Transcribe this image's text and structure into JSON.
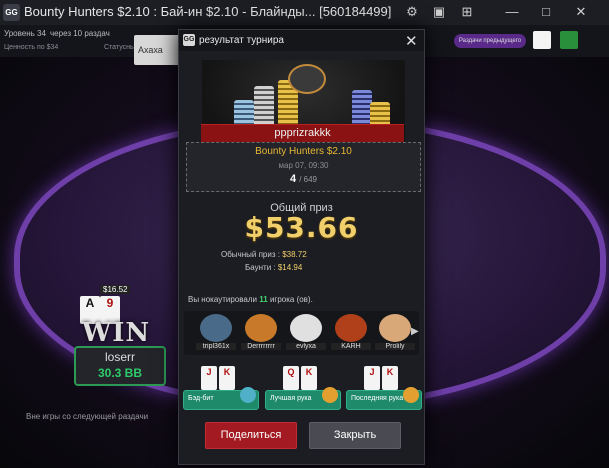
{
  "window": {
    "title": "Bounty Hunters $2.10 : Бай-ин $2.10 - Блайнды... [560184499]",
    "logo": "GG",
    "gear_icon": "gear-icon",
    "minimize_icon": "minimize-icon",
    "restore_icon": "restore-icon",
    "close_icon": "close-icon"
  },
  "info": {
    "level": "Уровень 34",
    "next_level": "через 10 раздач",
    "line2a": "Ценность по $34",
    "line2b": "Статусный бонус"
  },
  "table": {
    "chat_text": "Ахаха",
    "right_pill": "Раздачи предыдущего",
    "player": {
      "name": "loserr",
      "stack": "30.3 BB",
      "win_text": "WIN",
      "chip_amount": "$16.52",
      "cards": [
        "A",
        "9"
      ]
    },
    "sitout_text": "Вне игры со следующей раздачи"
  },
  "modal": {
    "title": "результат турнира",
    "winner": "ppprizrakkk",
    "tournament": "Bounty Hunters $2.10",
    "date": "мар 07, 09:30",
    "place": "4",
    "total": "/ 649",
    "prize_label": "Общий приз",
    "prize_amount": "$53.66",
    "regular_label": "Обычный приз :",
    "regular_value": "$38.72",
    "bounty_label": "Баунти :",
    "bounty_value": "$14.94",
    "knocked_prefix": "Вы нокаутировали",
    "knocked_count": "11",
    "knocked_suffix": "игрока (ов).",
    "knocked_players": [
      "tripl361x",
      "Derrrrrrrr",
      "evlyxa",
      "KARH",
      "Prolily"
    ],
    "badges": [
      {
        "label": "Бэд-бит",
        "cards": [
          "J",
          "K"
        ]
      },
      {
        "label": "Лучшая рука",
        "cards": [
          "Q",
          "K"
        ]
      },
      {
        "label": "Последняя рука",
        "cards": [
          "J",
          "K"
        ]
      }
    ],
    "share_label": "Поделиться",
    "close_label": "Закрыть"
  },
  "colors": {
    "accent_gold": "#f1cf6a",
    "share_red": "#a31a22",
    "felt_border": "#6e3fa8",
    "stack_green": "#2ecb6a"
  }
}
